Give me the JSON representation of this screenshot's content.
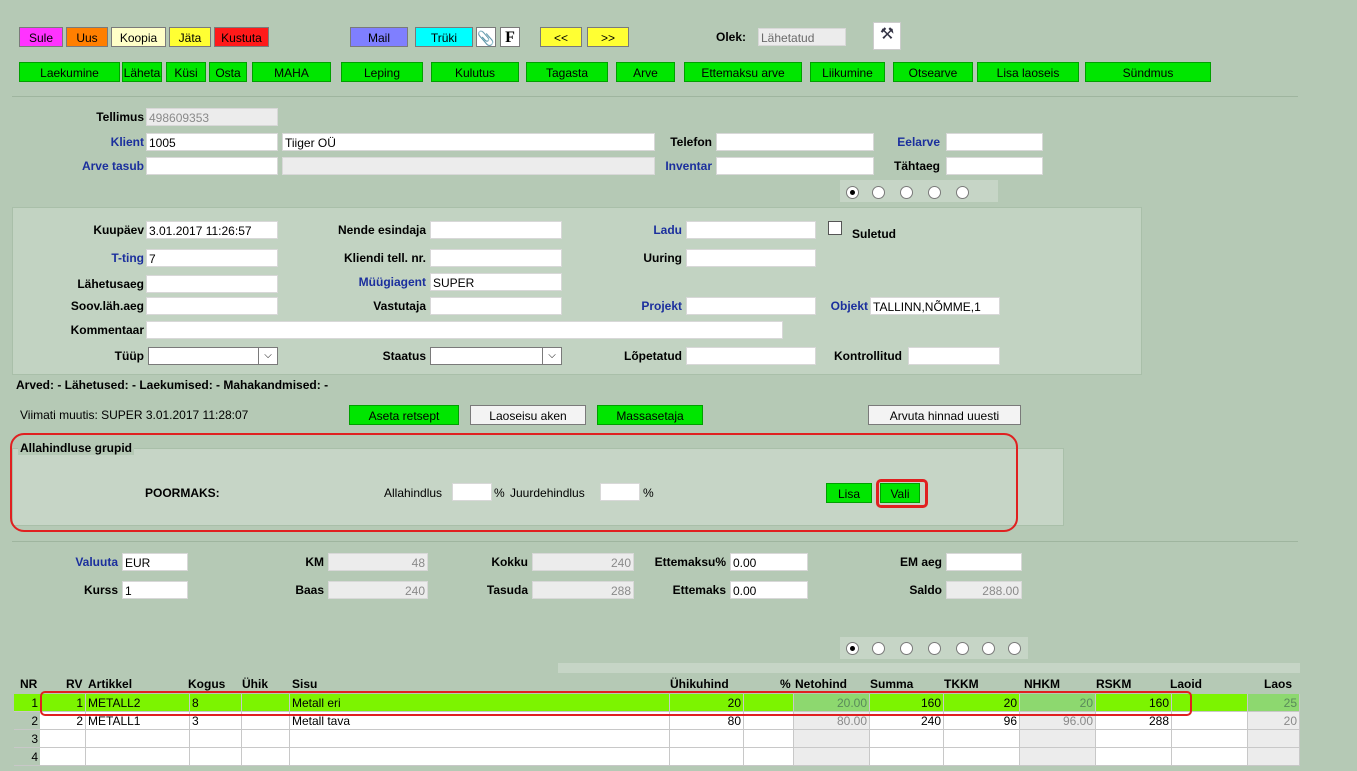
{
  "toolbar1": {
    "sule": "Sule",
    "uus": "Uus",
    "koopia": "Koopia",
    "jata": "Jäta",
    "kustuta": "Kustuta",
    "mail": "Mail",
    "truki": "Trüki",
    "attach": "0",
    "f": "F",
    "prev": "<<",
    "next": ">>",
    "status_label": "Olek:",
    "status_value": "Lähetatud"
  },
  "toolbar2": [
    "Laekumine",
    "Läheta",
    "Küsi",
    "Osta",
    "MAHA",
    "Leping",
    "Kulutus",
    "Tagasta",
    "Arve",
    "Ettemaksu arve",
    "Liikumine",
    "Otsearve",
    "Lisa laoseis",
    "Sündmus"
  ],
  "header": {
    "tellimus_label": "Tellimus",
    "tellimus_value": "498609353",
    "klient_label": "Klient",
    "klient_code": "1005",
    "klient_name": "Tiiger OÜ",
    "arve_tasub_label": "Arve tasub",
    "telefon_label": "Telefon",
    "inventar_label": "Inventar",
    "eelarve_label": "Eelarve",
    "tahtaeg_label": "Tähtaeg"
  },
  "details": {
    "kuupaev_label": "Kuupäev",
    "kuupaev_value": "3.01.2017 11:26:57",
    "tting_label": "T-ting",
    "tting_value": "7",
    "lahetusaeg_label": "Lähetusaeg",
    "soov_label": "Soov.läh.aeg",
    "kommentaar_label": "Kommentaar",
    "tyyp_label": "Tüüp",
    "nende_label": "Nende esindaja",
    "kliendi_tell_label": "Kliendi tell. nr.",
    "myygiagent_label": "Müügiagent",
    "myygiagent_value": "SUPER",
    "vastutaja_label": "Vastutaja",
    "staatus_label": "Staatus",
    "ladu_label": "Ladu",
    "uuring_label": "Uuring",
    "projekt_label": "Projekt",
    "lopetatud_label": "Lõpetatud",
    "suletud_label": "Suletud",
    "objekt_label": "Objekt",
    "objekt_value": "TALLINN,NÕMME,1",
    "kontrollitud_label": "Kontrollitud"
  },
  "summary_line": "Arved: - Lähetused: - Laekumised: - Mahakandmised: -",
  "actions": {
    "last_modified": "Viimati muutis: SUPER 3.01.2017 11:28:07",
    "aseta_retsept": "Aseta retsept",
    "laoseisu_aken": "Laoseisu aken",
    "massasetaja": "Massasetaja",
    "arvuta": "Arvuta hinnad uuesti"
  },
  "discount": {
    "title": "Allahindluse grupid",
    "group": "POORMAKS:",
    "allahindlus_label": "Allahindlus",
    "percent1": "%",
    "juurdehindlus_label": "Juurdehindlus",
    "percent2": "%",
    "lisa": "Lisa",
    "vali": "Vali"
  },
  "totals": {
    "valuuta_label": "Valuuta",
    "valuuta_value": "EUR",
    "kurss_label": "Kurss",
    "kurss_value": "1",
    "km_label": "KM",
    "km_value": "48",
    "baas_label": "Baas",
    "baas_value": "240",
    "kokku_label": "Kokku",
    "kokku_value": "240",
    "tasuda_label": "Tasuda",
    "tasuda_value": "288",
    "ettemaksu_pct_label": "Ettemaksu%",
    "ettemaksu_pct_value": "0.00",
    "ettemaks_label": "Ettemaks",
    "ettemaks_value": "0.00",
    "em_aeg_label": "EM aeg",
    "saldo_label": "Saldo",
    "saldo_value": "288.00"
  },
  "table": {
    "headers": [
      "NR",
      "RV",
      "Artikkel",
      "Kogus",
      "Ühik",
      "Sisu",
      "Ühikuhind",
      "%",
      "Netohind",
      "Summa",
      "TKKM",
      "NHKM",
      "RSKM",
      "Laoid",
      "Laos"
    ],
    "rows": [
      {
        "nr": "1",
        "rv": "1",
        "artikkel": "METALL2",
        "kogus": "8",
        "yhik": "",
        "sisu": "Metall eri",
        "yhikuhind": "20",
        "pct": "",
        "netohind": "20.00",
        "summa": "160",
        "tkkm": "20",
        "nhkm": "20",
        "rskm": "160",
        "laoid": "",
        "laos": "25"
      },
      {
        "nr": "2",
        "rv": "2",
        "artikkel": "METALL1",
        "kogus": "3",
        "yhik": "",
        "sisu": "Metall tava",
        "yhikuhind": "80",
        "pct": "",
        "netohind": "80.00",
        "summa": "240",
        "tkkm": "96",
        "nhkm": "96.00",
        "rskm": "288",
        "laoid": "",
        "laos": "20"
      },
      {
        "nr": "3",
        "rv": "",
        "artikkel": "",
        "kogus": "",
        "yhik": "",
        "sisu": "",
        "yhikuhind": "",
        "pct": "",
        "netohind": "",
        "summa": "",
        "tkkm": "",
        "nhkm": "",
        "rskm": "",
        "laoid": "",
        "laos": ""
      },
      {
        "nr": "4",
        "rv": "",
        "artikkel": "",
        "kogus": "",
        "yhik": "",
        "sisu": "",
        "yhikuhind": "",
        "pct": "",
        "netohind": "",
        "summa": "",
        "tkkm": "",
        "nhkm": "",
        "rskm": "",
        "laoid": "",
        "laos": ""
      }
    ]
  },
  "colors": {
    "green": "#00e600",
    "highlight": "#e02020"
  }
}
